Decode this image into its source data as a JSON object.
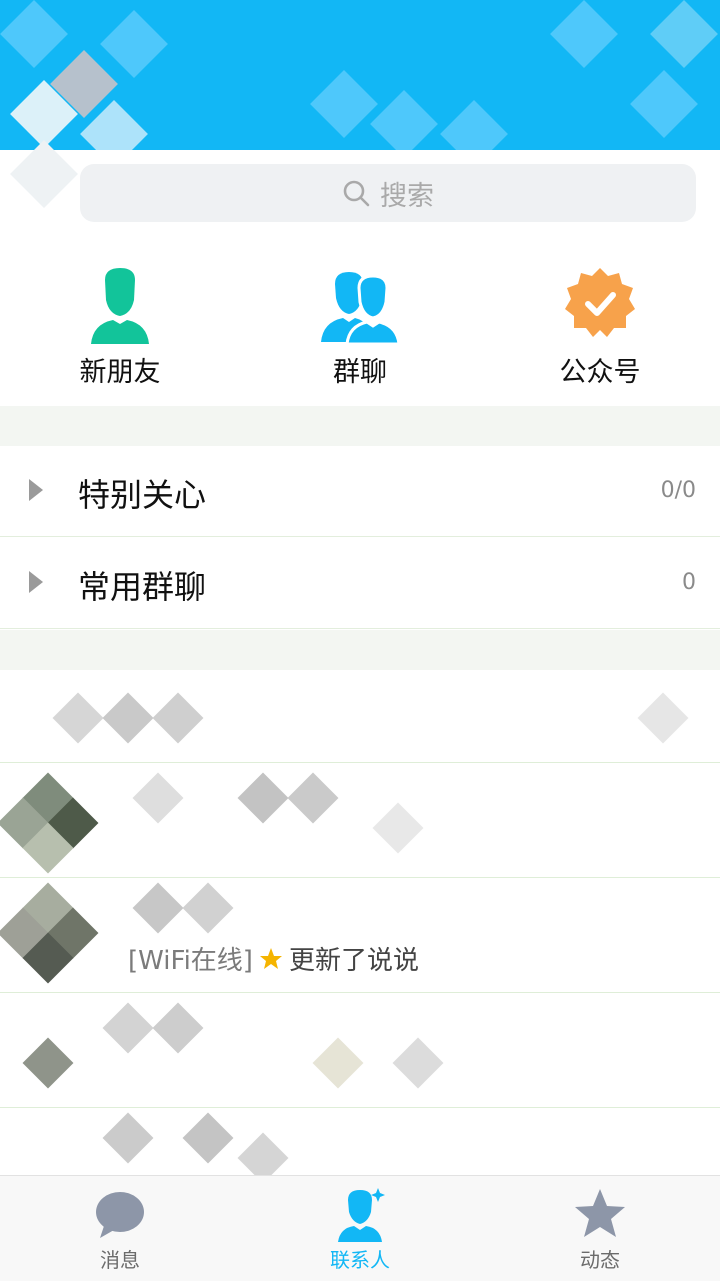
{
  "search": {
    "placeholder": "搜索"
  },
  "shortcuts": [
    {
      "label": "新朋友",
      "icon": "person-icon",
      "color": "#12c49a"
    },
    {
      "label": "群聊",
      "icon": "group-icon",
      "color": "#12b7f5"
    },
    {
      "label": "公众号",
      "icon": "verified-badge-icon",
      "color": "#f7a24b"
    }
  ],
  "groups": [
    {
      "title": "特别关心",
      "count": "0/0"
    },
    {
      "title": "常用群聊",
      "count": "0"
    }
  ],
  "contact_status": {
    "network": "[WiFi在线]",
    "activity": "更新了说说",
    "badge_icon": "star-badge-icon"
  },
  "tabbar": {
    "items": [
      {
        "label": "消息",
        "icon": "message-icon",
        "active": false
      },
      {
        "label": "联系人",
        "icon": "contacts-icon",
        "active": true
      },
      {
        "label": "动态",
        "icon": "star-icon",
        "active": false
      }
    ]
  },
  "colors": {
    "accent": "#12b7f5",
    "header_bg": "#12b7f5"
  }
}
